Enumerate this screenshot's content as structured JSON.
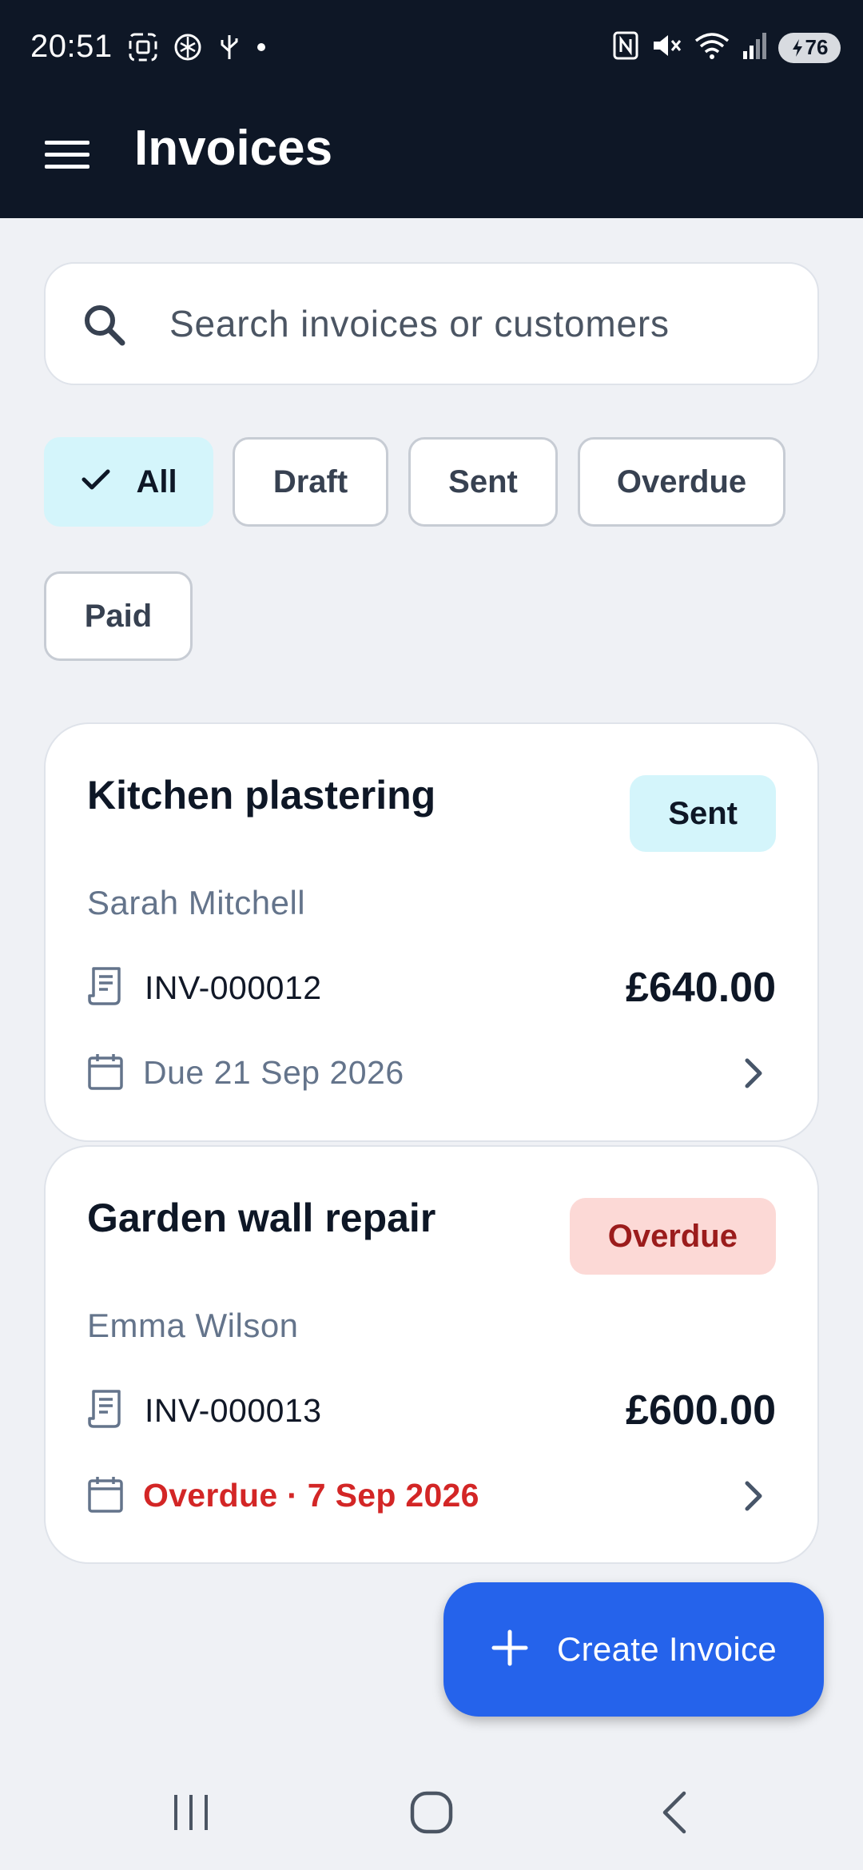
{
  "status_bar": {
    "time": "20:51",
    "battery": "76",
    "left_icons": [
      "screenshot-icon",
      "openai-icon",
      "usb-icon",
      "dot-icon"
    ],
    "right_icons": [
      "nfc-icon",
      "mute-icon",
      "wifi-icon",
      "signal-icon",
      "battery-icon"
    ]
  },
  "app_bar": {
    "title": "Invoices",
    "menu_icon": "menu-icon"
  },
  "search": {
    "placeholder": "Search invoices or customers",
    "icon": "search-icon"
  },
  "filters": [
    {
      "label": "All",
      "selected": true
    },
    {
      "label": "Draft",
      "selected": false
    },
    {
      "label": "Sent",
      "selected": false
    },
    {
      "label": "Overdue",
      "selected": false
    },
    {
      "label": "Paid",
      "selected": false
    }
  ],
  "invoices": [
    {
      "title": "Kitchen plastering",
      "status": "Sent",
      "customer": "Sarah Mitchell",
      "number": "INV-000012",
      "amount": "£640.00",
      "due": "Due 21 Sep 2026"
    },
    {
      "title": "Garden wall repair",
      "status": "Overdue",
      "customer": "Emma Wilson",
      "number": "INV-000013",
      "amount": "£600.00",
      "due": "Overdue · 7 Sep 2026"
    }
  ],
  "fab": {
    "label": "Create Invoice",
    "icon": "plus-icon"
  },
  "colors": {
    "header_bg": "#0e1726",
    "primary": "#2563eb",
    "chip_selected": "#d4f5fb",
    "overdue_text": "#d32626",
    "overdue_badge_bg": "#fcd9d6"
  },
  "nav_bar": [
    "recents-icon",
    "home-icon",
    "back-icon"
  ]
}
